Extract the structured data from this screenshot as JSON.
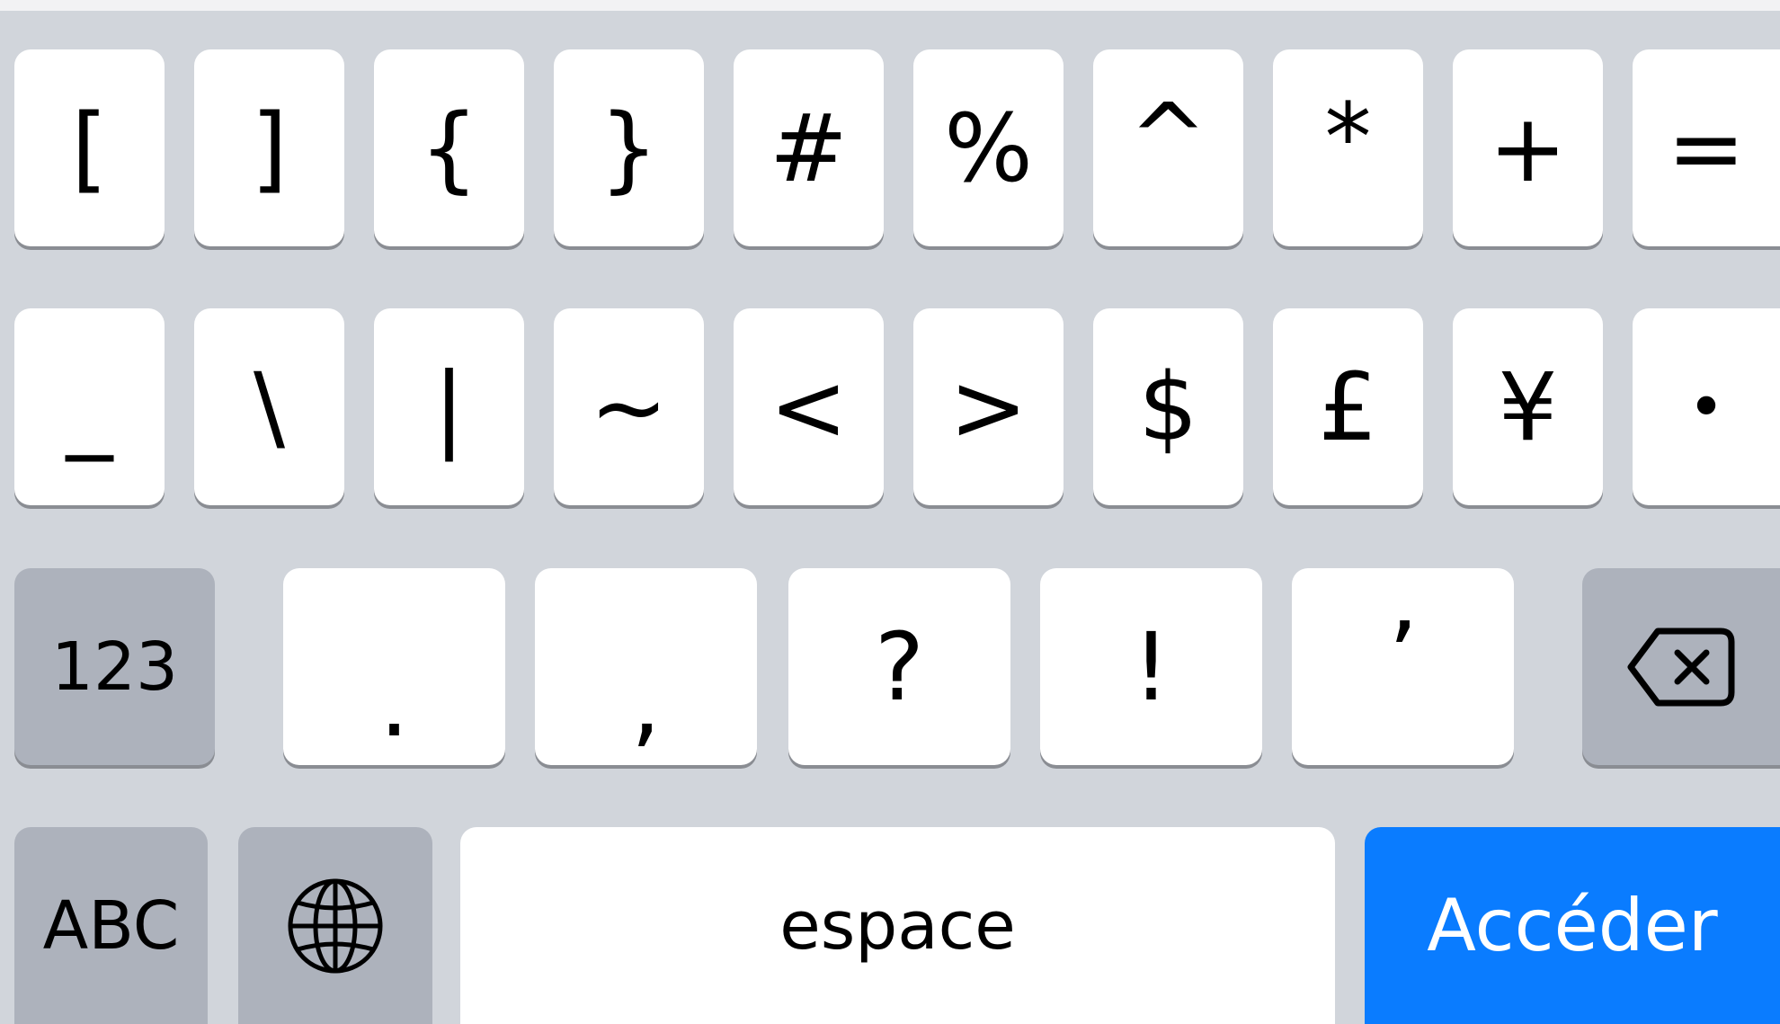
{
  "keyboard": {
    "row1": [
      "[",
      "]",
      "{",
      "}",
      "#",
      "%",
      "^",
      "*",
      "+",
      "="
    ],
    "row2": [
      "_",
      "\\",
      "|",
      "~",
      "<",
      ">",
      "$",
      "£",
      "¥",
      "•"
    ],
    "row3": {
      "mode_123": "123",
      "punct": [
        ".",
        ",",
        "?",
        "!",
        "’"
      ]
    },
    "row4": {
      "abc": "ABC",
      "space": "espace",
      "go": "Accéder"
    },
    "icons": {
      "delete": "delete-icon",
      "globe": "globe-icon"
    },
    "colors": {
      "background": "#d1d5db",
      "key": "#ffffff",
      "function_key": "#adb2bc",
      "accent": "#0a7cff"
    }
  }
}
